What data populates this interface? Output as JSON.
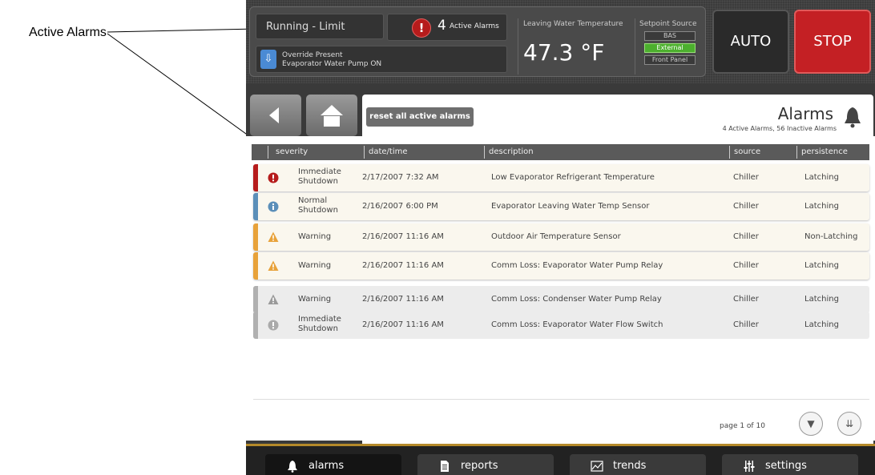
{
  "callout": {
    "label": "Active Alarms"
  },
  "status": {
    "mode_text": "Running - Limit",
    "alarm_count": "4",
    "alarm_count_label": "Active Alarms",
    "override_line1": "Override Present",
    "override_line2": "Evaporator Water Pump ON",
    "lwt_label": "Leaving Water Temperature",
    "lwt_value": "47.3 °F",
    "setpoint_label": "Setpoint Source",
    "setpoint_options": [
      "BAS",
      "External",
      "Front Panel"
    ],
    "setpoint_selected": "External",
    "auto_label": "AUTO",
    "stop_label": "STOP"
  },
  "toolbar": {
    "reset_label": "reset all active alarms",
    "title": "Alarms",
    "subtitle": "4 Active Alarms, 56 Inactive Alarms"
  },
  "table": {
    "headers": [
      "severity",
      "date/time",
      "description",
      "source",
      "persistence"
    ],
    "rows": [
      {
        "severity_l1": "Immediate",
        "severity_l2": "Shutdown",
        "datetime": "2/17/2007 7:32 AM",
        "description": "Low Evaporator Refrigerant Temperature",
        "source": "Chiller",
        "persistence": "Latching"
      },
      {
        "severity_l1": "Normal",
        "severity_l2": "Shutdown",
        "datetime": "2/16/2007 6:00 PM",
        "description": "Evaporator Leaving Water Temp Sensor",
        "source": "Chiller",
        "persistence": "Latching"
      },
      {
        "severity_l1": "Warning",
        "severity_l2": "",
        "datetime": "2/16/2007 11:16 AM",
        "description": "Outdoor Air Temperature Sensor",
        "source": "Chiller",
        "persistence": "Non-Latching"
      },
      {
        "severity_l1": "Warning",
        "severity_l2": "",
        "datetime": "2/16/2007 11:16 AM",
        "description": "Comm Loss: Evaporator Water Pump Relay",
        "source": "Chiller",
        "persistence": "Latching"
      },
      {
        "severity_l1": "Warning",
        "severity_l2": "",
        "datetime": "2/16/2007 11:16 AM",
        "description": "Comm Loss: Condenser Water Pump Relay",
        "source": "Chiller",
        "persistence": "Latching"
      },
      {
        "severity_l1": "Immediate",
        "severity_l2": "Shutdown",
        "datetime": "2/16/2007 11:16 AM",
        "description": "Comm Loss: Evaporator Water Flow Switch",
        "source": "Chiller",
        "persistence": "Latching"
      }
    ]
  },
  "pager": {
    "label": "page 1 of 10"
  },
  "nav": {
    "tabs": [
      "alarms",
      "reports",
      "trends",
      "settings"
    ],
    "selected": "alarms"
  },
  "colors": {
    "immediate": "#b61c1c",
    "normal": "#5b8fb9",
    "warning": "#e8a23a",
    "inactive": "#b0b0b0"
  }
}
